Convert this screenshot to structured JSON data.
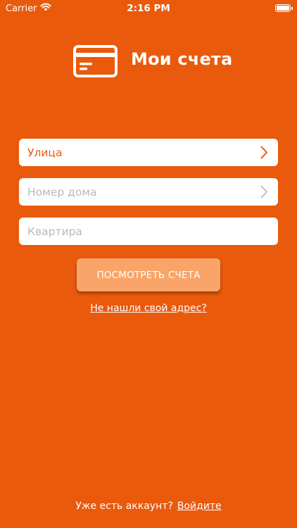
{
  "status_bar": {
    "carrier": "Carrier",
    "time": "2:16 PM"
  },
  "header": {
    "title": "Мои счета",
    "icon": "credit-card-icon"
  },
  "form": {
    "street": {
      "value": "Улица",
      "icon": "chevron-right-icon"
    },
    "house_number": {
      "placeholder": "Номер дома",
      "icon": "chevron-right-icon"
    },
    "apartment": {
      "placeholder": "Квартира",
      "value": ""
    }
  },
  "actions": {
    "view_bills_label": "ПОСМОТРЕТЬ СЧЕТА",
    "address_not_found_link": "Не нашли свой адрес?"
  },
  "footer": {
    "prompt": "Уже есть аккаунт?",
    "login_link": "Войдите"
  },
  "colors": {
    "background": "#EA5A0C",
    "button": "#F9A468",
    "selected_text": "#E35A12",
    "placeholder_text": "#B8B8BC",
    "field_background": "#FFFFFF"
  }
}
